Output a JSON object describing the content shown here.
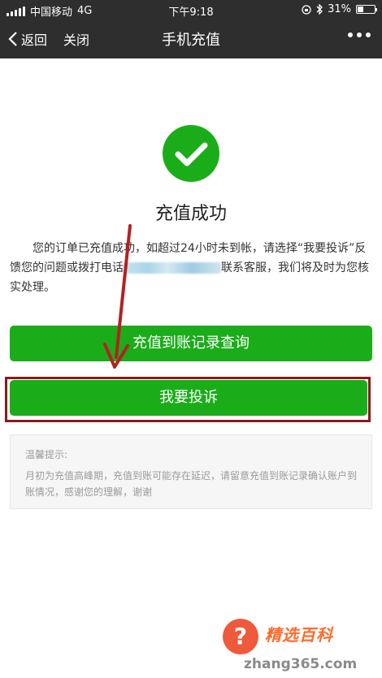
{
  "status_bar": {
    "carrier": "中国移动",
    "network": "4G",
    "time": "下午9:18",
    "battery_percent": "31%"
  },
  "nav": {
    "back_label": "返回",
    "close_label": "关闭",
    "title": "手机充值"
  },
  "result": {
    "title": "充值成功",
    "message_before": "您的订单已充值成功，如超过24小时未到帐，请选择“我要投诉”反馈您的问题或拨打电话",
    "message_after": "联系客服，我们将及时为您核实处理。"
  },
  "buttons": {
    "records_label": "充值到账记录查询",
    "complain_label": "我要投诉"
  },
  "tips": {
    "heading": "温馨提示:",
    "body": "月初为充值高峰期，充值到账可能存在延迟，请留意充值到账记录确认账户到账情况，感谢您的理解，谢谢"
  },
  "watermark": {
    "brand": "精选百科",
    "url": "zhang365.com"
  },
  "colors": {
    "primary_green": "#1aad19",
    "nav_background": "#2e2e2e",
    "annotation_red": "#b22222"
  }
}
